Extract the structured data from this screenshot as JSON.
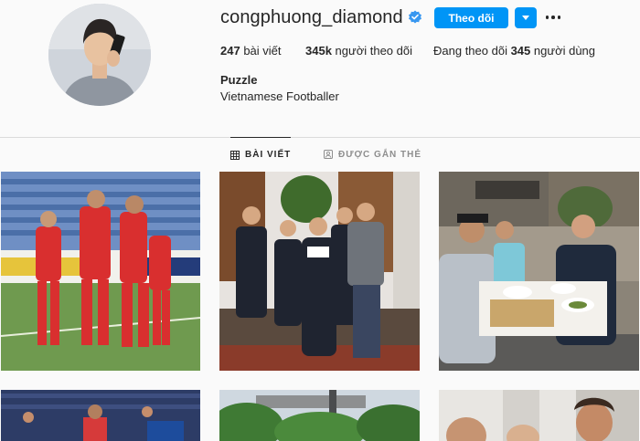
{
  "profile": {
    "username": "congphuong_diamond",
    "verified": true,
    "follow_label": "Theo dõi",
    "stats": {
      "posts_count": "247",
      "posts_label": "bài viết",
      "followers_count": "345k",
      "followers_label": "người theo dõi",
      "following_prefix": "Đang theo dõi",
      "following_count": "345",
      "following_label": "người dùng"
    },
    "full_name": "Puzzle",
    "bio": "Vietnamese Footballer"
  },
  "tabs": [
    {
      "label": "BÀI VIẾT",
      "icon": "grid-icon",
      "active": true
    },
    {
      "label": "ĐƯỢC GẮN THẺ",
      "icon": "tagged-icon",
      "active": false
    }
  ],
  "posts": [
    {
      "subject": "football-team-celebration"
    },
    {
      "subject": "family-group-photo"
    },
    {
      "subject": "restaurant-meal"
    },
    {
      "subject": "stadium-crowd"
    },
    {
      "subject": "outdoor-trees"
    },
    {
      "subject": "indoor-selfie"
    }
  ],
  "colors": {
    "accent": "#0095f6",
    "verified_badge": "#3897f0",
    "background": "#fafafa",
    "text": "#262626",
    "muted": "#8e8e8e"
  }
}
